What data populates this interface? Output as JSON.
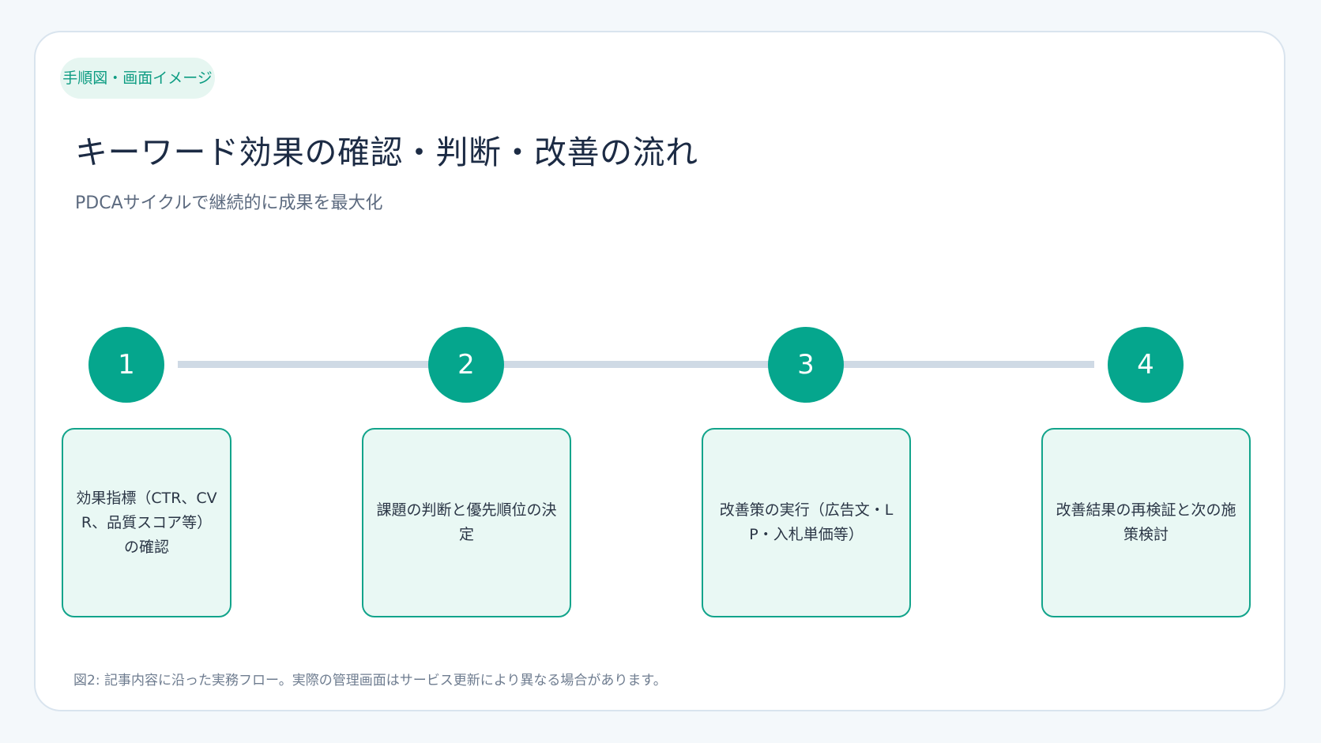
{
  "badge": "手順図・画面イメージ",
  "title": "キーワード効果の確認・判断・改善の流れ",
  "subtitle": "PDCAサイクルで継続的に成果を最大化",
  "steps": [
    {
      "number": "1",
      "text": "効果指標（CTR、CVR、品質スコア等）の確認"
    },
    {
      "number": "2",
      "text": "課題の判断と優先順位の決定"
    },
    {
      "number": "3",
      "text": "改善策の実行（広告文・LP・入札単価等）"
    },
    {
      "number": "4",
      "text": "改善結果の再検証と次の施策検討"
    }
  ],
  "caption": "図2:  記事内容に沿った実務フロー。実際の管理画面はサービス更新により異なる場合があります。",
  "colors": {
    "accent": "#05a68d",
    "step_box_fill": "#e9f8f4",
    "connector": "#cfdae5",
    "title": "#1c2b44"
  }
}
